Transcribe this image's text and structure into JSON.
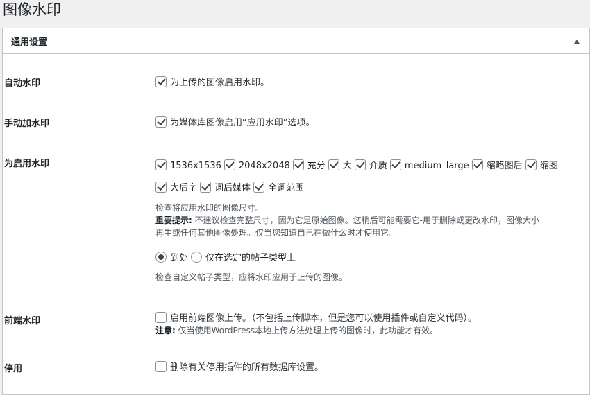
{
  "page": {
    "title": "图像水印"
  },
  "box": {
    "title": "通用设置"
  },
  "rows": {
    "auto": {
      "label": "自动水印",
      "option": "为上传的图像启用水印。",
      "checked": true
    },
    "manual": {
      "label": "手动加水印",
      "option": "为媒体库图像启用“应用水印”选项。",
      "checked": true
    },
    "sizes": {
      "label": "为启用水印",
      "items": [
        "1536x1536",
        "2048x2048",
        "充分",
        "大",
        "介质",
        "medium_large",
        "缩略图后",
        "缩图",
        "大后字",
        "词后媒体",
        "全词范围"
      ],
      "desc": "检查将应用水印的图像尺寸。",
      "important_label": "重要提示:",
      "important_line1": "不建议检查完整尺寸，因为它是原始图像。您稍后可能需要它-用于删除或更改水印，图像大小",
      "important_line2": "再生或任何其他图像处理。仅当您知道自己在做什么时才使用它。",
      "radio_everywhere": "到处",
      "radio_selected": "仅在选定的帖子类型上",
      "radio_desc": "检查自定义帖子类型，应将水印应用于上传的图像。"
    },
    "frontend": {
      "label": "前端水印",
      "option": "启用前端图像上传。（不包括上传脚本，但是您可以使用插件或自定义代码）。",
      "note_label": "注意:",
      "note": "仅当使用WordPress本地上传方法处理上传的图像时，此功能才有效。",
      "checked": false
    },
    "deactivate": {
      "label": "停用",
      "option": "删除有关停用插件的所有数据库设置。",
      "checked": false
    }
  }
}
